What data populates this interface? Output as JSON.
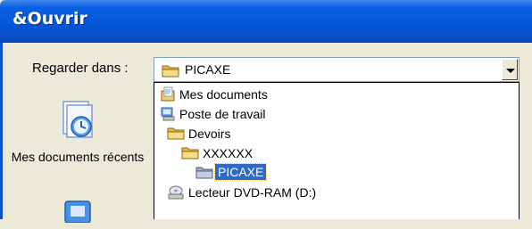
{
  "window": {
    "title": "&Ouvrir"
  },
  "look_in": {
    "label": "Regarder dans :",
    "value": "PICAXE",
    "icon": "folder-icon"
  },
  "places": [
    {
      "label": "Mes documents récents",
      "icon": "recent-documents-icon"
    },
    {
      "label": "",
      "icon": "desktop-icon"
    }
  ],
  "dropdown": {
    "items": [
      {
        "label": "Mes documents",
        "icon": "my-documents-icon",
        "level": 0
      },
      {
        "label": "Poste de travail",
        "icon": "my-computer-icon",
        "level": 0
      },
      {
        "label": "Devoirs",
        "icon": "folder-icon",
        "level": 1
      },
      {
        "label": "XXXXXX",
        "icon": "folder-icon",
        "level": 2
      },
      {
        "label": "PICAXE",
        "icon": "folder-icon",
        "level": 3,
        "selected": true
      },
      {
        "label": "Lecteur DVD-RAM (D:)",
        "icon": "dvd-drive-icon",
        "level": 1
      }
    ]
  },
  "colors": {
    "title_bar": "#0457d8",
    "window_bg": "#ece9d8",
    "selection": "#316ac5",
    "folder": "#f5d57a"
  }
}
